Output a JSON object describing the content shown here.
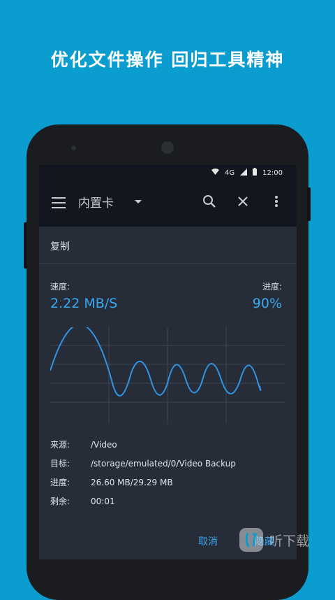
{
  "headline": "优化文件操作  回归工具精神",
  "status_bar": {
    "network": "4G",
    "time": "12:00"
  },
  "app_bar": {
    "title": "内置卡"
  },
  "dialog": {
    "title": "复制",
    "speed_label": "速度:",
    "speed_value": "2.22 MB/S",
    "progress_label": "进度:",
    "progress_value": "90%",
    "details": [
      {
        "key": "来源:",
        "value": "/Video"
      },
      {
        "key": "目标:",
        "value": "/storage/emulated/0/Video Backup"
      },
      {
        "key": "进度:",
        "value": "26.60 MB/29.29 MB"
      },
      {
        "key": "剩余:",
        "value": "00:01"
      }
    ],
    "cancel_label": "取消",
    "hide_label": "隐藏"
  },
  "watermark": {
    "text": "听下载"
  },
  "colors": {
    "background": "#0b9dcf",
    "accent": "#38a8f0",
    "screen": "#272d38",
    "toolbar": "#12161f"
  }
}
